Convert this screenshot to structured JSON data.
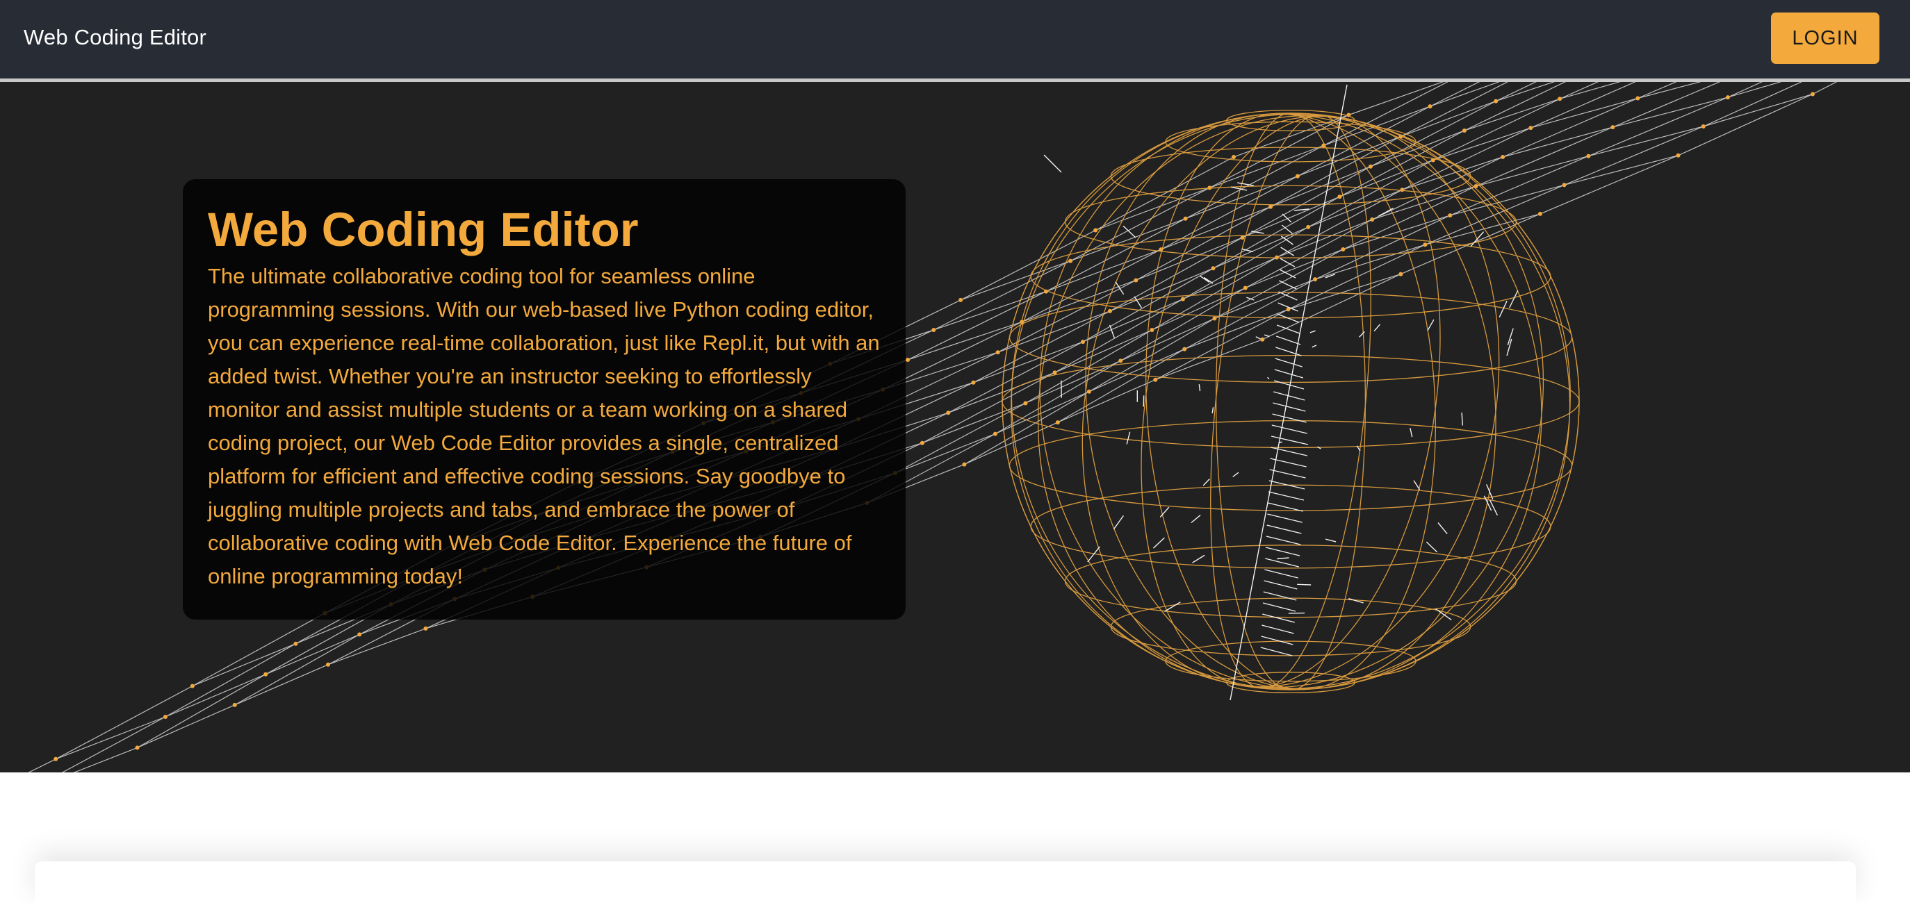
{
  "navbar": {
    "brand": "Web Coding Editor",
    "login_label": "LOGIN"
  },
  "hero": {
    "title": "Web Coding Editor",
    "description": "The ultimate collaborative coding tool for seamless online programming sessions. With our web-based live Python coding editor, you can experience real-time collaboration, just like Repl.it, but with an added twist. Whether you're an instructor seeking to effortlessly monitor and assist multiple students or a team working on a shared coding project, our Web Code Editor provides a single, centralized platform for efficient and effective coding sessions. Say goodbye to juggling multiple projects and tabs, and embrace the power of collaborative coding with Web Code Editor. Experience the future of online programming today!"
  },
  "colors": {
    "navbar_bg": "#282c35",
    "accent": "#f3a93c",
    "hero_bg": "#212121"
  }
}
